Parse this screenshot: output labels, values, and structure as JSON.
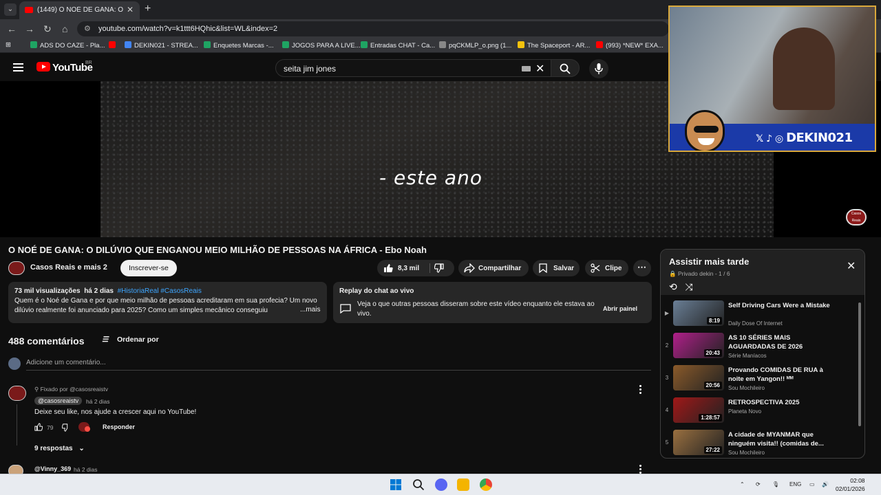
{
  "browser": {
    "tab_title": "(1449) O NOÉ DE GANA: O DILÚ",
    "url": "youtube.com/watch?v=k1ttt6HQhic&list=WL&index=2",
    "bookmarks": [
      "ADS DO CAZE - Pla...",
      "DEKIN021 - STREA...",
      "Enquetes Marcas -...",
      "JOGOS PARA A LIVE...",
      "Entradas CHAT - Ca...",
      "pqCKMLP_o.png (1...",
      "The Spaceport - AR...",
      "(993) *NEW* EXA..."
    ]
  },
  "header": {
    "logo": "YouTube",
    "region": "BR",
    "search_query": "seita jim jones"
  },
  "video": {
    "caption": "- este ano",
    "watermark": "Casos Reais",
    "overlay_handle": "DEKIN021"
  },
  "meta": {
    "title": "O NOÉ DE GANA: O DILÚVIO QUE ENGANOU MEIO MILHÃO DE PESSOAS NA ÁFRICA - Ebo Noah",
    "channel": "Casos Reais e mais 2",
    "subscribe": "Inscrever-se",
    "likes": "8,3 mil",
    "share": "Compartilhar",
    "save": "Salvar",
    "clip": "Clipe"
  },
  "description": {
    "views": "73 mil visualizações",
    "age": "há 2 dias",
    "tags": "#HistoriaReal #CasosReais",
    "text": "Quem é o Noé de Gana e por que meio milhão de pessoas acreditaram em sua profecia? Um novo dilúvio realmente foi anunciado para 2025? Como um simples mecânico conseguiu",
    "more": "...mais"
  },
  "chat_replay": {
    "title": "Replay do chat ao vivo",
    "body": "Veja o que outras pessoas disseram sobre este vídeo enquanto ele estava ao vivo.",
    "open": "Abrir painel"
  },
  "comments": {
    "count": "488 comentários",
    "sort": "Ordenar por",
    "placeholder": "Adicione um comentário...",
    "pinned": "Fixado por @casosreaistv",
    "first": {
      "author": "@casosreaistv",
      "time": "há 2 dias",
      "text": "Deixe seu like, nos ajude a crescer aqui no YouTube!",
      "likes": "79",
      "reply": "Responder",
      "replies": "9 respostas"
    },
    "second": {
      "author": "@Vinny_369",
      "time": "há 2 dias"
    }
  },
  "playlist": {
    "title": "Assistir mais tarde",
    "subtitle": "Privado  dekin - 1 / 6",
    "items": [
      {
        "index": "▶",
        "title": "Self Driving Cars Were a Mistake",
        "channel": "Daily Dose Of Internet",
        "duration": "8:19",
        "color": "#6a7f96"
      },
      {
        "index": "2",
        "title": "AS 10 SÉRIES MAIS AGUARDADAS DE 2026",
        "channel": "Série Maníacos",
        "duration": "20:43",
        "color": "#b0208a"
      },
      {
        "index": "3",
        "title": "Provando COMIDAS DE RUA à noite em Yangon!! ᴹᴹ",
        "channel": "Sou Mochileiro",
        "duration": "20:56",
        "color": "#8a5a2a"
      },
      {
        "index": "4",
        "title": "RETROSPECTIVA 2025",
        "channel": "Planeta Novo",
        "duration": "1:28:57",
        "color": "#a01818"
      },
      {
        "index": "5",
        "title": "A cidade de MYANMAR que ninguém visita!! (comidas de...",
        "channel": "Sou Mochileiro",
        "duration": "27:22",
        "color": "#9a7040"
      }
    ]
  },
  "taskbar": {
    "lang": "ENG",
    "time": "02:08",
    "date": "02/01/2026"
  }
}
